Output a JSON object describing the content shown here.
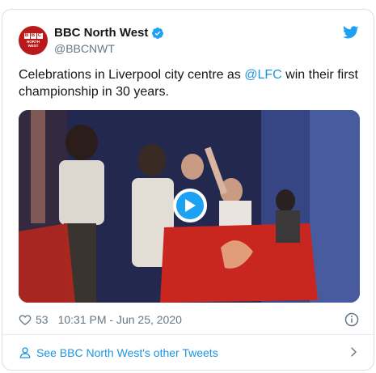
{
  "account": {
    "display_name": "BBC North West",
    "handle": "@BBCNWT",
    "avatar_blocks": [
      "B",
      "B",
      "C"
    ],
    "avatar_line1": "NORTH",
    "avatar_line2": "WEST",
    "verified_icon": "verified-badge-icon"
  },
  "tweet": {
    "text_before": "Celebrations in Liverpool city centre as ",
    "mention": "@LFC",
    "text_after": " win their first championship in 30 years."
  },
  "media": {
    "type": "video",
    "play_icon": "play-icon"
  },
  "meta": {
    "like_count": "53",
    "timestamp": "10:31 PM - Jun 25, 2020"
  },
  "footer": {
    "link_text": "See BBC North West's other Tweets"
  },
  "colors": {
    "accent": "#1da1f2",
    "link": "#1b95e0",
    "bbc_red": "#bb1919",
    "text_primary": "#14171a",
    "text_secondary": "#657786",
    "border": "#d9dfe3"
  }
}
